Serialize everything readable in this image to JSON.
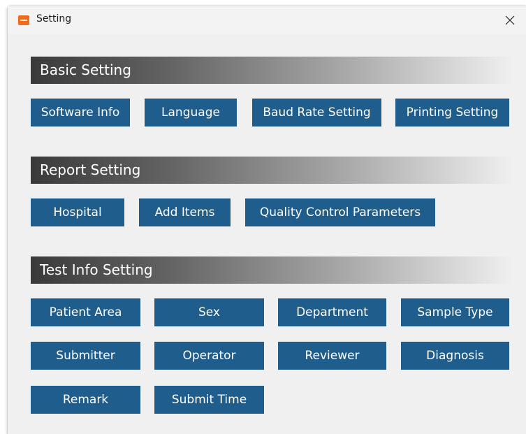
{
  "window": {
    "title": "Setting",
    "app_icon": "orange-app-icon",
    "close_icon": "close-icon"
  },
  "colors": {
    "button_bg": "#1f5d8c",
    "button_text": "#ffffff",
    "header_dark": "#3a3a3a",
    "window_bg": "#f0f0f0",
    "app_icon": "#f26b1d"
  },
  "sections": {
    "basic": {
      "title": "Basic Setting",
      "buttons": [
        "Software Info",
        "Language",
        "Baud Rate Setting",
        "Printing Setting"
      ]
    },
    "report": {
      "title": "Report Setting",
      "buttons": [
        "Hospital",
        "Add Items",
        "Quality Control Parameters"
      ]
    },
    "test_info": {
      "title": "Test Info Setting",
      "buttons": [
        "Patient Area",
        "Sex",
        "Department",
        "Sample Type",
        "Submitter",
        "Operator",
        "Reviewer",
        "Diagnosis",
        "Remark",
        "Submit Time"
      ]
    }
  }
}
